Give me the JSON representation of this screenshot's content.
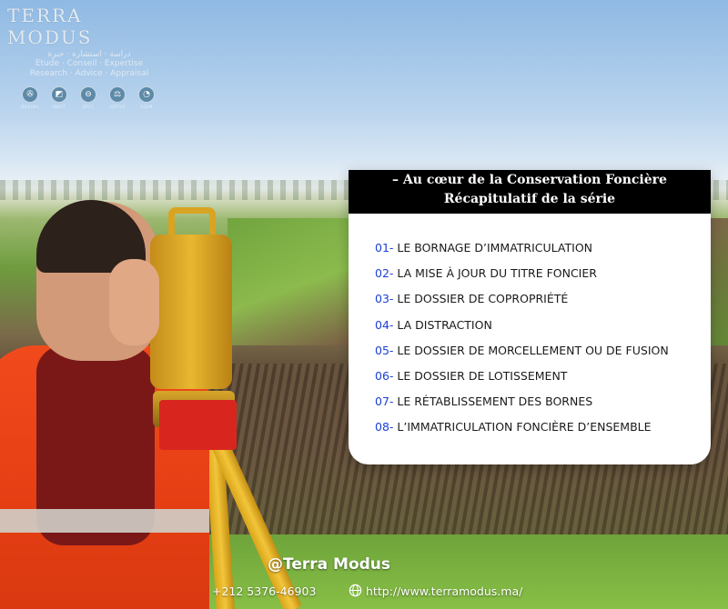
{
  "logo": {
    "title": "TERRA MODUS",
    "arabic": "دراسة · استشارة · خبرة",
    "sub_fr": "Etude · Conseil · Expertise",
    "sub_en": "Research · Advice · Appraisal",
    "icons": [
      {
        "name": "ircsurv-icon",
        "label": "IRCSURV",
        "glyph": "✇"
      },
      {
        "name": "onigt-icon",
        "label": "ONIGT",
        "glyph": "◩"
      },
      {
        "name": "dpct-icon",
        "label": "DPCT",
        "glyph": "⊖"
      },
      {
        "name": "justice-icon",
        "label": "JUSTICE",
        "glyph": "⚖"
      },
      {
        "name": "ogem-icon",
        "label": "OGEM",
        "glyph": "◔"
      }
    ]
  },
  "panel": {
    "title_line1": "– Au cœur de la Conservation Foncière",
    "title_line2": "Récapitulatif de la série",
    "items": [
      {
        "num": "01-",
        "text": "LE BORNAGE D’IMMATRICULATION"
      },
      {
        "num": "02-",
        "text": "LA MISE À JOUR DU TITRE FONCIER"
      },
      {
        "num": "03-",
        "text": "LE DOSSIER DE COPROPRIÉTÉ"
      },
      {
        "num": "04-",
        "text": "LA DISTRACTION"
      },
      {
        "num": "05-",
        "text": "LE DOSSIER DE MORCELLEMENT OU DE FUSION"
      },
      {
        "num": "06-",
        "text": "LE DOSSIER DE LOTISSEMENT"
      },
      {
        "num": "07-",
        "text": "LE RÉTABLISSEMENT DES BORNES"
      },
      {
        "num": "08-",
        "text": "L’IMMATRICULATION FONCIÈRE D’ENSEMBLE"
      }
    ]
  },
  "footer": {
    "handle": "@Terra Modus",
    "phone": "+212 5376-46903",
    "website": "http://www.terramodus.ma/"
  },
  "colors": {
    "accent_number": "#1a3fd6",
    "header_bg": "#000000",
    "panel_bg": "#ffffff"
  }
}
